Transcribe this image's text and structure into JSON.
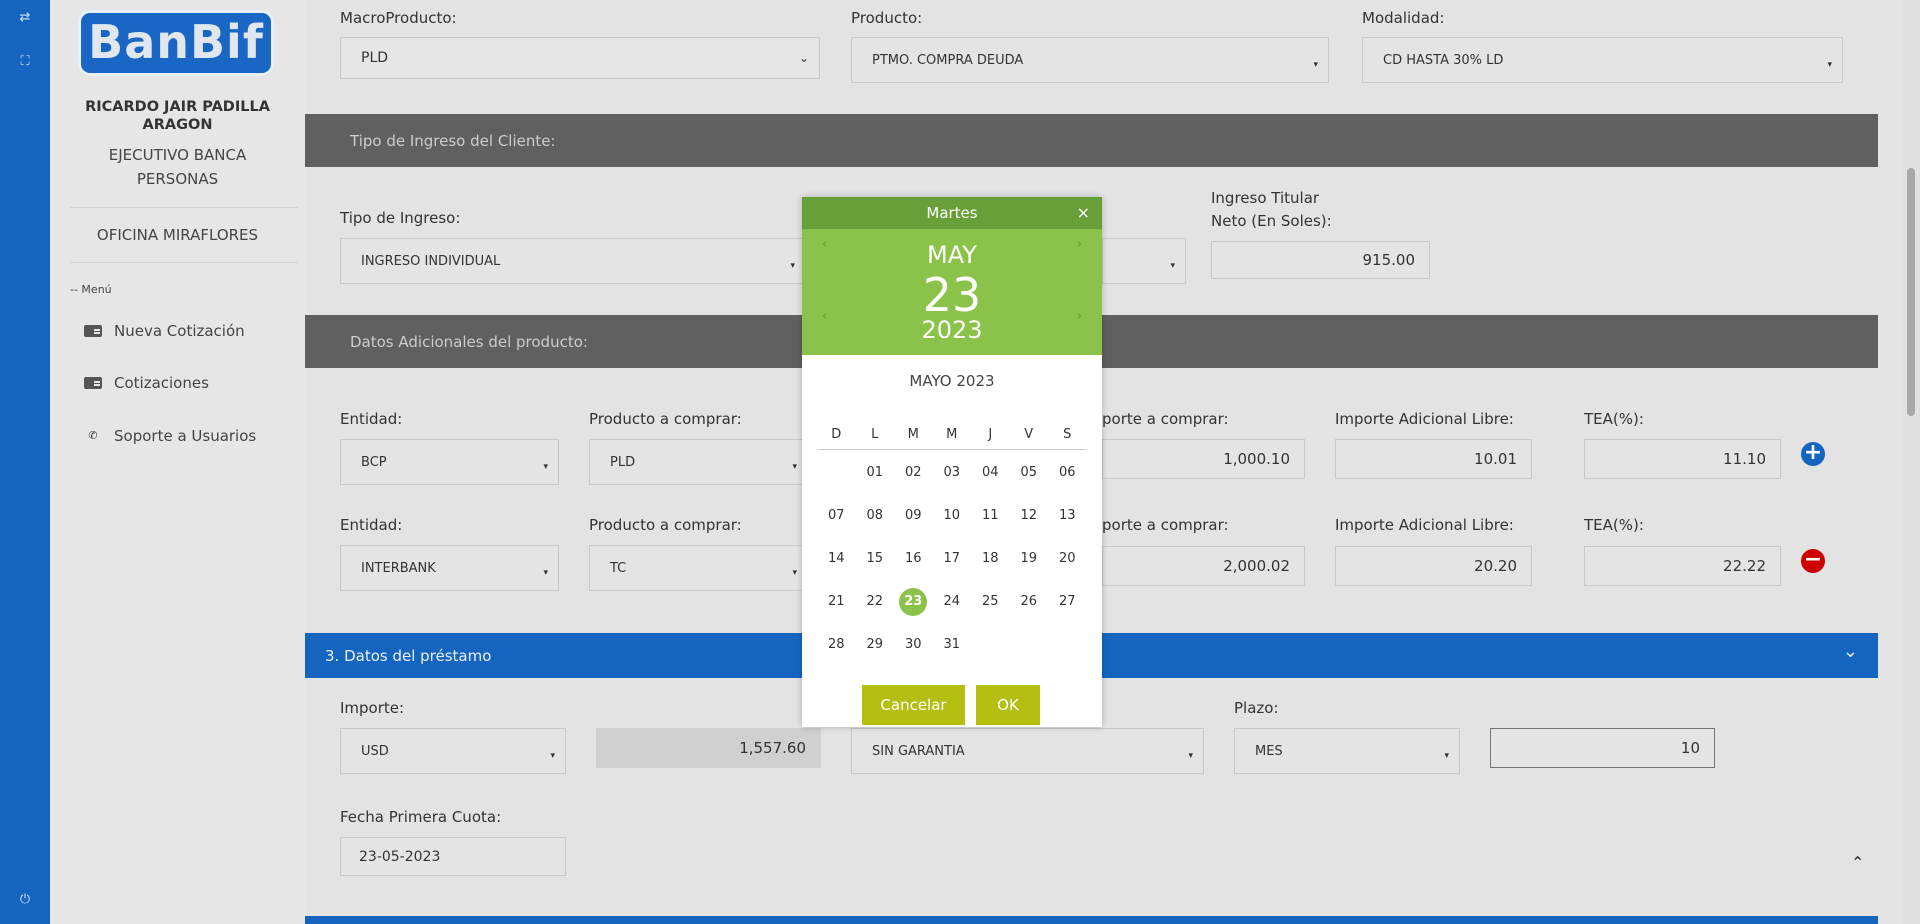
{
  "sidebar": {
    "logo_text": "BanBif",
    "user_name": "RICARDO JAIR PADILLA ARAGON",
    "user_role": "EJECUTIVO BANCA PERSONAS",
    "office": "OFICINA MIRAFLORES",
    "menu_header": "-- Menú",
    "items": [
      {
        "label": "Nueva Cotización",
        "icon": "id-card-icon"
      },
      {
        "label": "Cotizaciones",
        "icon": "id-card-icon"
      },
      {
        "label": "Soporte a Usuarios",
        "icon": "phone-icon"
      }
    ]
  },
  "product": {
    "macro_label": "MacroProducto:",
    "macro_value": "PLD",
    "product_label": "Producto:",
    "product_value": "PTMO. COMPRA DEUDA",
    "mode_label": "Modalidad:",
    "mode_value": "CD HASTA 30% LD"
  },
  "income": {
    "section_title": "Tipo de Ingreso del Cliente:",
    "type_label": "Tipo de Ingreso:",
    "type_value": "INGRESO INDIVIDUAL",
    "net_label": "Ingreso Titular Neto (En Soles):",
    "net_value": "915.00"
  },
  "additional": {
    "section_title": "Datos Adicionales del producto:",
    "entity_label": "Entidad:",
    "product_label": "Producto a comprar:",
    "amount_label": "porte a comprar:",
    "extra_label": "Importe Adicional Libre:",
    "tea_label": "TEA(%):",
    "rows": [
      {
        "entity": "BCP",
        "product": "PLD",
        "amount": "1,000.10",
        "extra": "10.01",
        "tea": "11.10"
      },
      {
        "entity": "INTERBANK",
        "product": "TC",
        "amount": "2,000.02",
        "extra": "20.20",
        "tea": "22.22"
      }
    ]
  },
  "loan": {
    "section_title": "3. Datos del préstamo",
    "amount_label": "Importe:",
    "currency": "USD",
    "amount": "1,557.60",
    "guarantee": "SIN GARANTIA",
    "term_label": "Plazo:",
    "term_unit": "MES",
    "term_value": "10",
    "first_payment_label": "Fecha Primera Cuota:",
    "first_payment_value": "23-05-2023"
  },
  "datepicker": {
    "weekday_header": "Martes",
    "close": "×",
    "big_month": "MAY",
    "big_day": "23",
    "big_year": "2023",
    "month_title": "MAYO 2023",
    "weekdays": [
      "D",
      "L",
      "M",
      "M",
      "J",
      "V",
      "S"
    ],
    "weeks": [
      [
        "",
        "01",
        "02",
        "03",
        "04",
        "05",
        "06"
      ],
      [
        "07",
        "08",
        "09",
        "10",
        "11",
        "12",
        "13"
      ],
      [
        "14",
        "15",
        "16",
        "17",
        "18",
        "19",
        "20"
      ],
      [
        "21",
        "22",
        "23",
        "24",
        "25",
        "26",
        "27"
      ],
      [
        "28",
        "29",
        "30",
        "31",
        "",
        "",
        ""
      ]
    ],
    "selected": "23",
    "cancel_label": "Cancelar",
    "ok_label": "OK"
  },
  "colors": {
    "rail": "#1565c0",
    "header_green": "#689f38",
    "picker_green": "#8bc34a",
    "button_olive": "#b5bf12",
    "section_gray": "#606060",
    "add_button": "#1565c0",
    "remove_button": "#cc0000"
  }
}
